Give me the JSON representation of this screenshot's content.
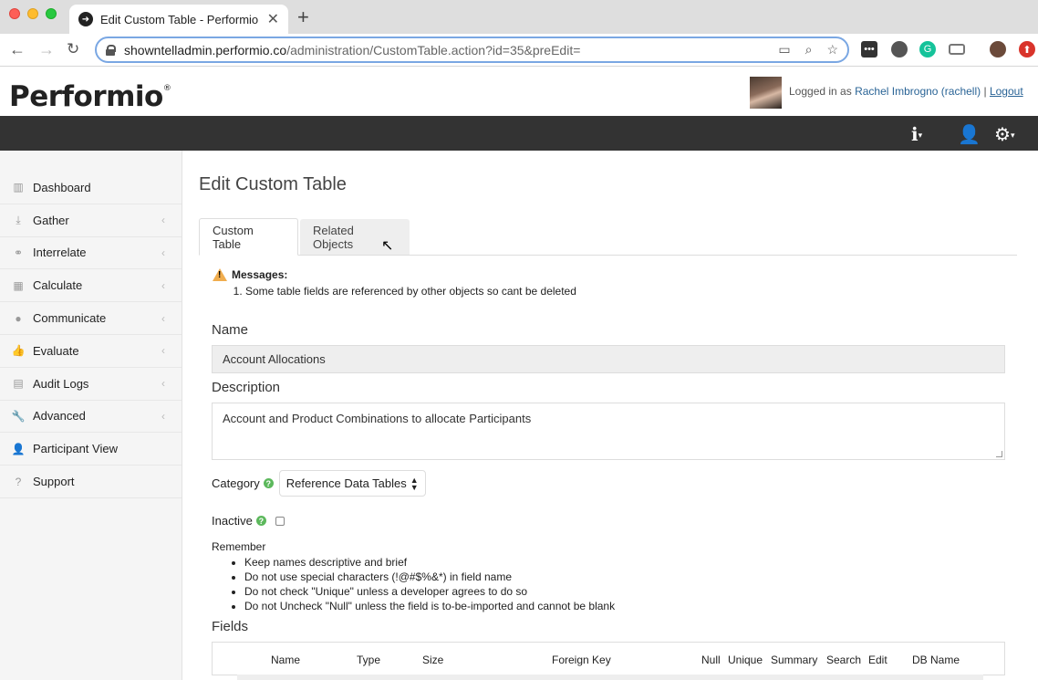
{
  "browser": {
    "tab_title": "Edit Custom Table - Performio",
    "tab_close": "✕",
    "new_tab": "+",
    "url_host": "showntelladmin.performio.co",
    "url_path": "/administration/CustomTable.action?id=35&preEdit="
  },
  "header": {
    "logo": "Performio",
    "logo_mark": "®",
    "logged_in_prefix": "Logged in as",
    "user_name": "Rachel Imbrogno (rachell)",
    "separator": "|",
    "logout": "Logout"
  },
  "navbar": {
    "icons": [
      "info-icon",
      "user-icon",
      "gear-icon"
    ]
  },
  "sidebar": {
    "items": [
      {
        "label": "Dashboard",
        "icon": "bar-chart-icon",
        "chevron": false
      },
      {
        "label": "Gather",
        "icon": "download-icon",
        "chevron": true
      },
      {
        "label": "Interrelate",
        "icon": "link-icon",
        "chevron": true
      },
      {
        "label": "Calculate",
        "icon": "table-icon",
        "chevron": true
      },
      {
        "label": "Communicate",
        "icon": "comments-icon",
        "chevron": true
      },
      {
        "label": "Evaluate",
        "icon": "thumbs-up-icon",
        "chevron": true
      },
      {
        "label": "Audit Logs",
        "icon": "file-icon",
        "chevron": true
      },
      {
        "label": "Advanced",
        "icon": "wrench-icon",
        "chevron": true
      },
      {
        "label": "Participant View",
        "icon": "user-icon",
        "chevron": false
      },
      {
        "label": "Support",
        "icon": "question-icon",
        "chevron": false
      }
    ]
  },
  "main": {
    "title": "Edit Custom Table",
    "tabs": [
      {
        "label": "Custom Table",
        "active": true
      },
      {
        "label": "Related Objects",
        "active": false
      }
    ],
    "messages": {
      "heading": "Messages:",
      "items": [
        "Some table fields are referenced by other objects so cant be deleted"
      ]
    },
    "name_label": "Name",
    "name_value": "Account Allocations",
    "description_label": "Description",
    "description_value": "Account and Product Combinations to allocate Participants",
    "category_label": "Category",
    "category_value": "Reference Data Tables",
    "inactive_label": "Inactive",
    "inactive_checked": false,
    "remember": {
      "heading": "Remember",
      "items": [
        "Keep names descriptive and brief",
        "Do not use special characters (!@#$%&*) in field name",
        "Do not check \"Unique\" unless a developer agrees to do so",
        "Do not Uncheck \"Null\" unless the field is to-be-imported and cannot be blank"
      ]
    },
    "fields_label": "Fields",
    "fields_columns": [
      "Name",
      "Type",
      "Size",
      "Foreign Key",
      "Null",
      "Unique",
      "Summary",
      "Search",
      "Edit",
      "DB Name"
    ]
  },
  "colors": {
    "navbar": "#333333",
    "sidebar": "#f5f5f5",
    "link": "#2a6496",
    "help": "#5cb85c",
    "warning": "#f0ad4e"
  }
}
